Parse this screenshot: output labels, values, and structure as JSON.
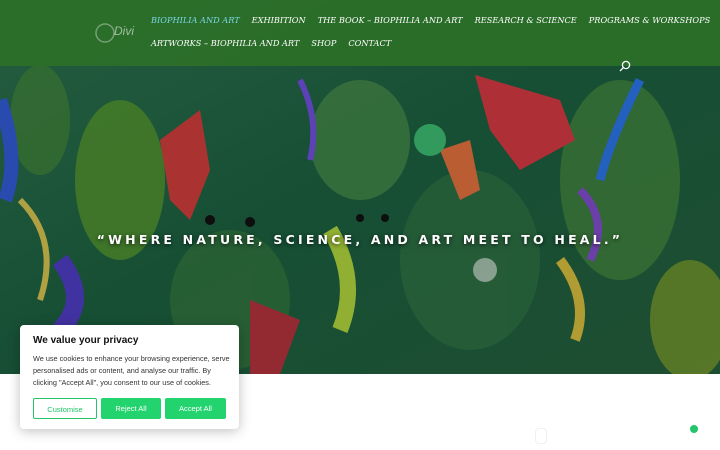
{
  "nav": {
    "row1": [
      "BIOPHILIA AND ART",
      "EXHIBITION",
      "THE BOOK – BIOPHILIA AND ART",
      "RESEARCH & SCIENCE",
      "PROGRAMS & WORKSHOPS"
    ],
    "row2": [
      "ARTWORKS – BIOPHILIA AND ART",
      "SHOP",
      "CONTACT"
    ],
    "active_color": "#7ad6e2"
  },
  "logo": {
    "text": "Divi"
  },
  "hero": {
    "quote": "“WHERE NATURE, SCIENCE, AND ART MEET TO HEAL.”"
  },
  "cookie": {
    "title": "We value your privacy",
    "body": "We use cookies to enhance your browsing experience, serve personalised ads or content, and analyse our traffic. By clicking \"Accept All\", you consent to our use of cookies.",
    "customise": "Customise",
    "reject": "Reject All",
    "accept": "Accept All"
  },
  "colors": {
    "header": "#2c7028",
    "accent": "#22d36e"
  },
  "icons": {
    "search": "search-icon",
    "chat": "chat-icon"
  }
}
